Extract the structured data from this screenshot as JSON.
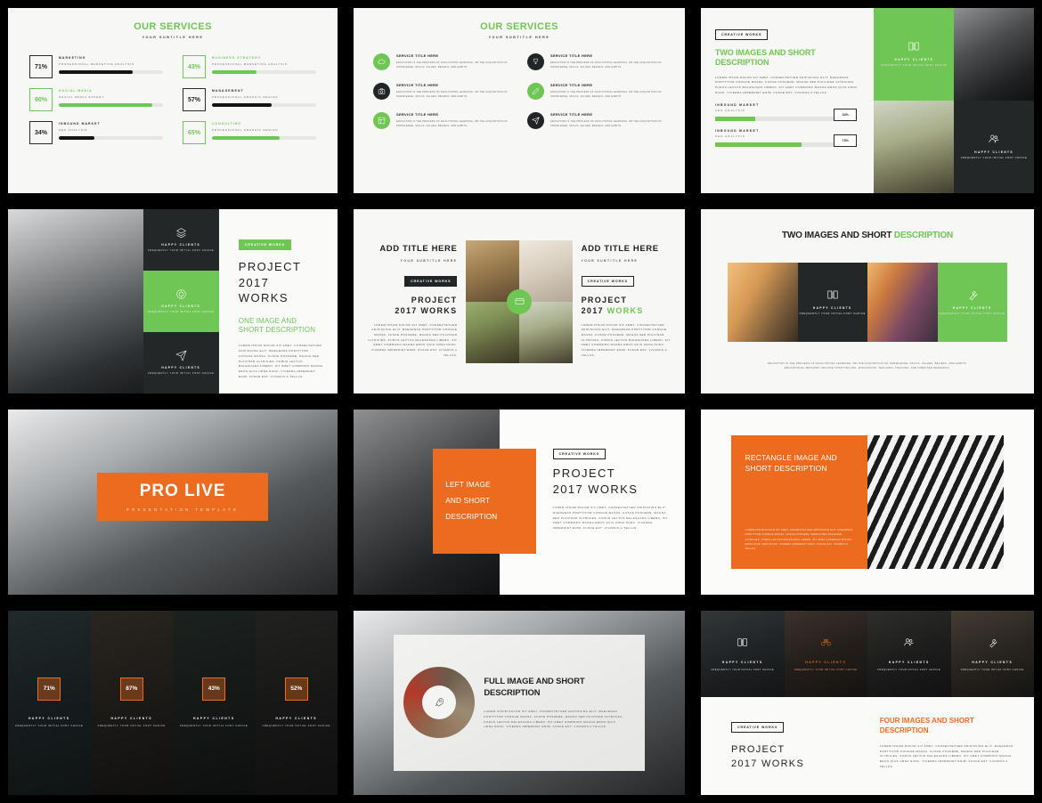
{
  "theme": {
    "green": "#6fc654",
    "orange": "#ec6b1e",
    "dark": "#242727",
    "light": "#f7f7f6"
  },
  "common": {
    "lorem": "LOREM IPSUM DOLOR SIT AMET, CONSECTETUER ADIPISCING ELIT. MAECENAS PORTTITOR CONGUE MASSA. FUSCE POSUERE, MAGNA SED PULVINAR ULTRICIES, PURUS LECTUS MALESUADA LIBERO, SIT AMET COMMODO MAGNA EROS QUIS URNA NUNC. VIVERRA IMPERDIET ENIM. FUSCE EST. VIVAMUS A TELLUS.",
    "education": "EDUCATION IS THE PROCESS OF FACILITATING LEARNING, OR THE ACQUISITION OF KNOWLEDGE, SKILLS, VALUES, BELIEFS, AND HABITS.",
    "happy_clients": "HAPPY CLIENTS",
    "frequently": "FREQUENTLY YOUR INITIAL FONT CHOICE",
    "creative_works": "CREATIVE WORKS",
    "project": "PROJECT",
    "project_year": "2017 WORKS",
    "service_title": "SERVICE TITLE HERE"
  },
  "slide1": {
    "title": "OUR SERVICES",
    "subtitle": "YOUR SUBTITLE HERE",
    "bars": [
      {
        "pct": "71%",
        "value": 71,
        "label": "MARKETING",
        "sub": "PROFESSIONAL MARKETING ANALYSIS",
        "color": "dark"
      },
      {
        "pct": "43%",
        "value": 43,
        "label": "BUSINESS STRATEGY",
        "sub": "PROFESSIONAL MARKETING ANALYSIS",
        "color": "green"
      },
      {
        "pct": "90%",
        "value": 90,
        "label": "SOCIAL MEDIA",
        "sub": "SOCIAL MEDIA EXPERT",
        "color": "green"
      },
      {
        "pct": "57%",
        "value": 57,
        "label": "MANAGEMENT",
        "sub": "PROFESSIONAL GRAPHIC DESIGN",
        "color": "dark"
      },
      {
        "pct": "34%",
        "value": 34,
        "label": "INBOUND MARKET",
        "sub": "SEO ANALYSIS",
        "color": "dark"
      },
      {
        "pct": "65%",
        "value": 65,
        "label": "CONSULTING",
        "sub": "PROFESSIONAL GRAPHIC DESIGN",
        "color": "green"
      }
    ]
  },
  "slide2": {
    "title": "OUR SERVICES",
    "subtitle": "YOUR SUBTITLE HERE",
    "items": [
      {
        "title": "SERVICE TITLE HERE",
        "icon": "cloud-icon",
        "circle": "green"
      },
      {
        "title": "SERVICE TITLE HERE",
        "icon": "trophy-icon",
        "circle": "dark"
      },
      {
        "title": "SERVICE TITLE HERE",
        "icon": "camera-icon",
        "circle": "dark"
      },
      {
        "title": "SERVICE TITLE HERE",
        "icon": "pencil-icon",
        "circle": "green"
      },
      {
        "title": "SERVICE TITLE HERE",
        "icon": "layout-icon",
        "circle": "green"
      },
      {
        "title": "SERVICE TITLE HERE",
        "icon": "paperplane-icon",
        "circle": "dark"
      }
    ]
  },
  "slide3": {
    "tag": "CREATIVE WORKS",
    "heading": "TWO IMAGES AND SHORT DESCRIPTION",
    "bars": [
      {
        "label": "INBOUND MARKET",
        "sub": "SEO ANALYSIS",
        "pct": "34%",
        "value": 34
      },
      {
        "label": "INBOUND MARKET",
        "sub": "SEO ANALYSIS",
        "pct": "73%",
        "value": 73
      }
    ],
    "panels": [
      {
        "kind": "color-green",
        "icon": "book-icon",
        "label": "HAPPY CLIENTS",
        "sub": "FREQUENTLY YOUR INITIAL FONT CHOICE"
      },
      {
        "kind": "photo-model",
        "icon": "",
        "label": "",
        "sub": ""
      },
      {
        "kind": "photo-girl",
        "icon": "",
        "label": "",
        "sub": ""
      },
      {
        "kind": "color-dark",
        "icon": "people-icon",
        "label": "HAPPY CLIENTS",
        "sub": "FREQUENTLY YOUR INITIAL FONT CHOICE"
      }
    ]
  },
  "slide4": {
    "tag": "CREATIVE WORKS",
    "project": "PROJECT",
    "project_year": "2017 WORKS",
    "subheading": "ONE IMAGE AND SHORT DESCRIPTION",
    "cells": [
      {
        "icon": "layers-icon",
        "label": "HAPPY CLIENTS",
        "sub": "FREQUENTLY YOUR INITIAL FONT CHOICE",
        "bg": "dark"
      },
      {
        "icon": "target-icon",
        "label": "HAPPY CLIENTS",
        "sub": "FREQUENTLY YOUR INITIAL FONT CHOICE",
        "bg": "green"
      },
      {
        "icon": "paperplane-icon",
        "label": "HAPPY CLIENTS",
        "sub": "FREQUENTLY YOUR INITIAL FONT CHOICE",
        "bg": "dark"
      }
    ]
  },
  "slide5": {
    "left": {
      "title": "ADD TITLE HERE",
      "subtitle": "YOUR SUBTITLE HERE",
      "tag": "CREATIVE WORKS",
      "project": "PROJECT",
      "project_year": "2017 WORKS"
    },
    "right": {
      "title": "ADD TITLE HERE",
      "subtitle": "YOUR SUBTITLE HERE",
      "tag": "CREATIVE WORKS",
      "project": "PROJECT",
      "project_year_a": "2017 ",
      "project_year_b": "WORKS"
    },
    "badge_icon": "card-icon"
  },
  "slide6": {
    "heading_dark": "TWO IMAGES AND SHORT ",
    "heading_green": "DESCRIPTION",
    "footer": "EDUCATION IS THE PROCESS OF FACILITATING LEARNING, OR THE ACQUISITION OF KNOWLEDGE, SKILLS, VALUES, BELIEFS, AND HABITS. EDUCATIONAL METHODS INCLUDE STORYTELLING, DISCUSSION, TEACHING, TRAINING, AND DIRECTED RESEARCH.",
    "panels": [
      {
        "kind": "photo-sun",
        "icon": "",
        "label": "",
        "sub": ""
      },
      {
        "kind": "color-dark",
        "icon": "book-icon",
        "label": "HAPPY CLIENTS",
        "sub": "FREQUENTLY YOUR INITIAL FONT CHOICE"
      },
      {
        "kind": "photo-tractor",
        "icon": "",
        "label": "",
        "sub": ""
      },
      {
        "kind": "color-green",
        "icon": "wrench-icon",
        "label": "HAPPY CLIENTS",
        "sub": "FREQUENTLY YOUR INITIAL FONT CHOICE"
      }
    ]
  },
  "slide7": {
    "title": "PRO LIVE",
    "subtitle": "PRESENTATION TEMPLATE"
  },
  "slide8": {
    "block_lines": [
      "LEFT IMAGE",
      "AND SHORT",
      "DESCRIPTION"
    ],
    "tag": "CREATIVE WORKS",
    "project": "PROJECT",
    "project_year": "2017 WORKS"
  },
  "slide9": {
    "heading": "RECTANGLE IMAGE AND SHORT DESCRIPTION"
  },
  "slide10": {
    "stats": [
      {
        "pct": "71%",
        "label": "HAPPY CLIENTS",
        "sub": "FREQUENTLY YOUR INITIAL FONT CHOICE"
      },
      {
        "pct": "87%",
        "label": "HAPPY CLIENTS",
        "sub": "FREQUENTLY YOUR INITIAL FONT CHOICE"
      },
      {
        "pct": "43%",
        "label": "HAPPY CLIENTS",
        "sub": "FREQUENTLY YOUR INITIAL FONT CHOICE"
      },
      {
        "pct": "52%",
        "label": "HAPPY CLIENTS",
        "sub": "FREQUENTLY YOUR INITIAL FONT CHOICE"
      }
    ]
  },
  "slide11": {
    "heading": "FULL IMAGE AND SHORT DESCRIPTION",
    "badge_icon": "rocket-icon"
  },
  "slide12": {
    "tiles": [
      {
        "icon": "book-icon",
        "label": "HAPPY CLIENTS",
        "sub": "FREQUENTLY YOUR INITIAL FONT CHOICE",
        "accent": false
      },
      {
        "icon": "binocular-icon",
        "label": "HAPPY CLIENTS",
        "sub": "FREQUENTLY YOUR INITIAL FONT CHOICE",
        "accent": true
      },
      {
        "icon": "people-icon",
        "label": "HAPPY CLIENTS",
        "sub": "FREQUENTLY YOUR INITIAL FONT CHOICE",
        "accent": false
      },
      {
        "icon": "wrench-icon",
        "label": "HAPPY CLIENTS",
        "sub": "FREQUENTLY YOUR INITIAL FONT CHOICE",
        "accent": false
      }
    ],
    "tag": "CREATIVE WORKS",
    "project": "PROJECT",
    "project_year": "2017 WORKS",
    "heading": "FOUR IMAGES AND SHORT DESCRIPTION"
  }
}
